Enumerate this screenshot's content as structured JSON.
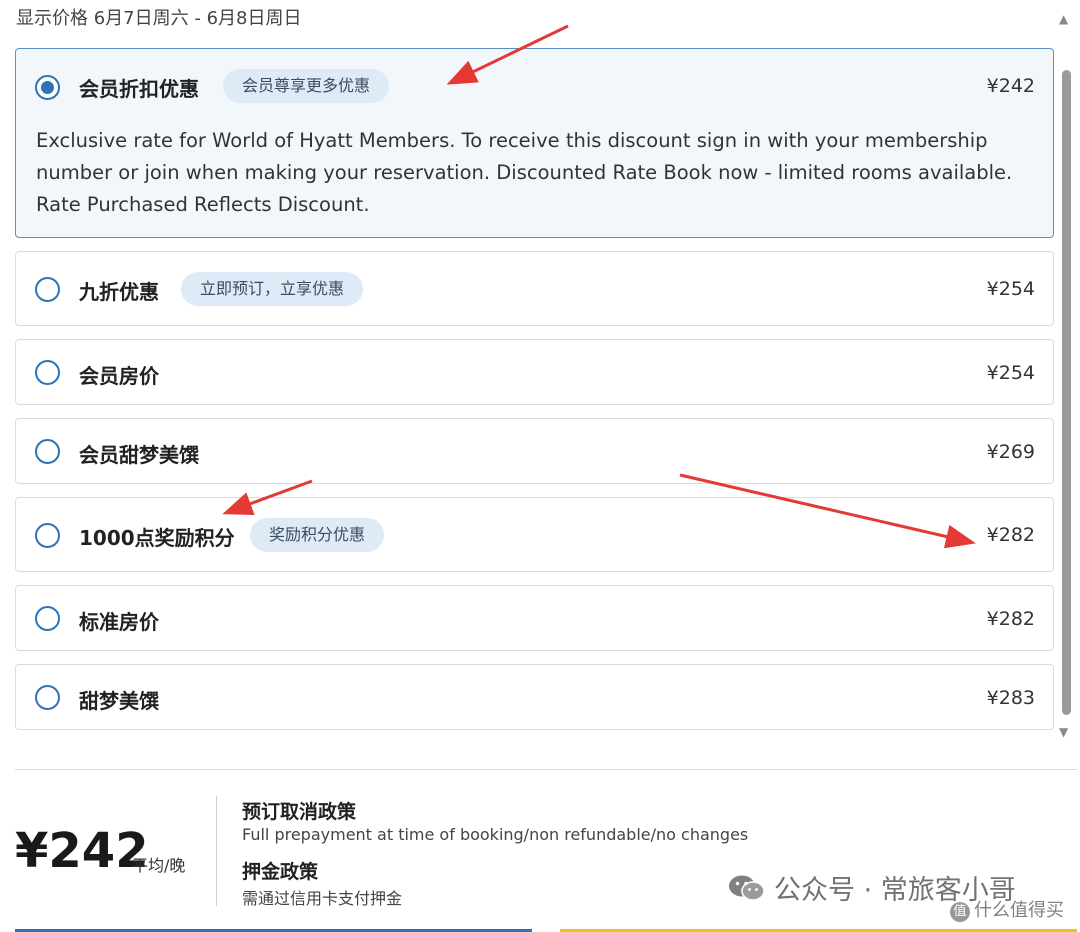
{
  "header": {
    "text": "显示价格 6月7日周六 - 6月8日周日"
  },
  "options": [
    {
      "name": "会员折扣优惠",
      "badge": "会员尊享更多优惠",
      "price": "¥242",
      "selected": true,
      "description": "Exclusive rate for World of Hyatt Members. To receive this discount sign in with your membership number or join when making your reservation. Discounted Rate Book now - limited rooms available. Rate Purchased Reflects Discount."
    },
    {
      "name": "九折优惠",
      "badge": "立即预订，立享优惠",
      "price": "¥254",
      "selected": false
    },
    {
      "name": "会员房价",
      "price": "¥254",
      "selected": false
    },
    {
      "name": "会员甜梦美馔",
      "price": "¥269",
      "selected": false
    },
    {
      "name": "1000点奖励积分",
      "badge": "奖励积分优惠",
      "price": "¥282",
      "selected": false
    },
    {
      "name": "标准房价",
      "price": "¥282",
      "selected": false
    },
    {
      "name": "甜梦美馔",
      "price": "¥283",
      "selected": false
    }
  ],
  "summary": {
    "total": "¥242",
    "unit": "平均/晚",
    "cancel_policy_title": "预订取消政策",
    "cancel_policy_text": "Full prepayment at time of booking/non refundable/no changes",
    "deposit_policy_title": "押金政策",
    "deposit_policy_text": "需通过信用卡支付押金"
  },
  "watermark": {
    "text": "公众号 · 常旅客小哥",
    "corner": "什么值得买"
  },
  "colors": {
    "accent": "#2f73b6",
    "badge_bg": "#dfeaf7",
    "annotation_arrow": "#e53935"
  },
  "icons": {
    "radio_selected": "radio-selected-icon",
    "radio_unselected": "radio-unselected-icon",
    "wechat": "wechat-icon"
  }
}
